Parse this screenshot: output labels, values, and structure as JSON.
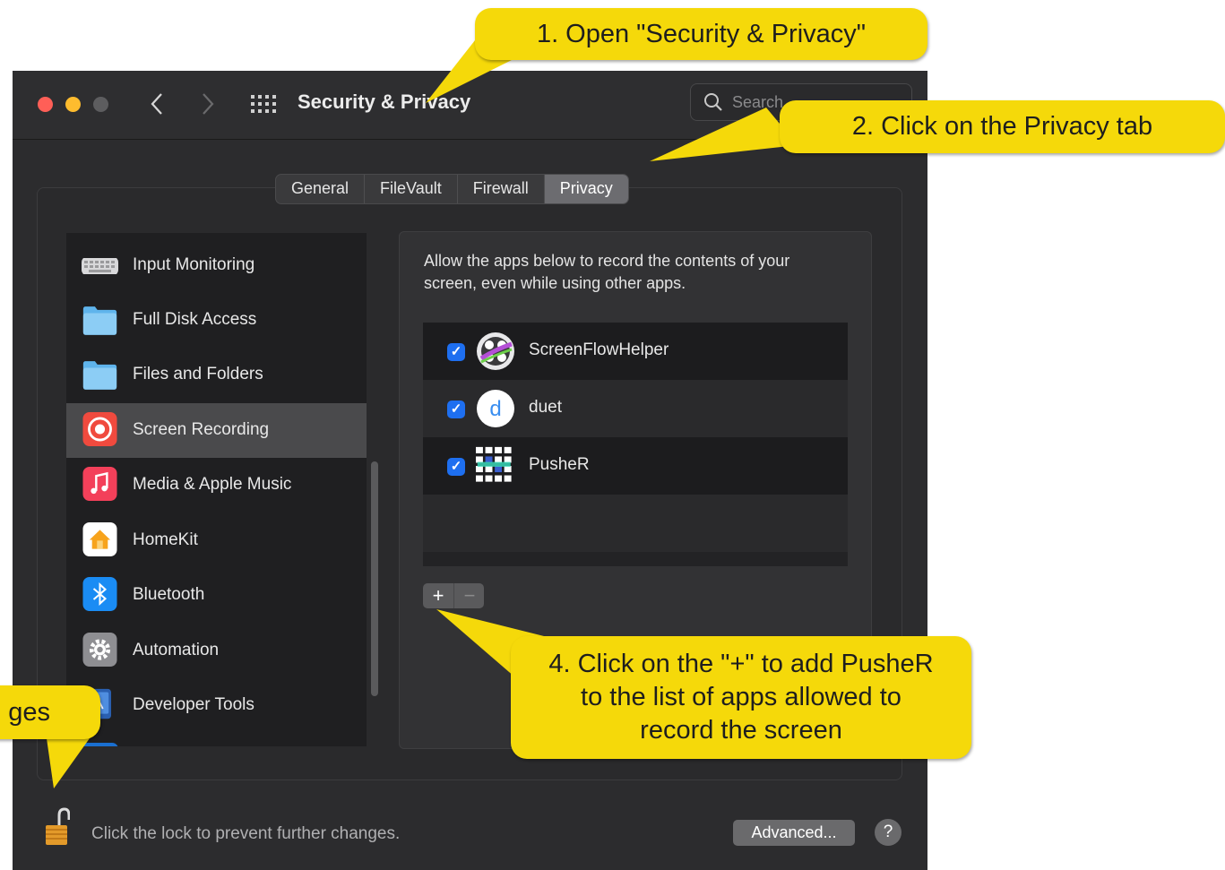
{
  "window": {
    "title": "Security & Privacy",
    "search_placeholder": "Search",
    "traffic_colors": {
      "close": "#ff5f57",
      "minimize": "#febc2e",
      "zoom": "#5d5d5f"
    }
  },
  "tabs": [
    {
      "label": "General",
      "active": false
    },
    {
      "label": "FileVault",
      "active": false
    },
    {
      "label": "Firewall",
      "active": false
    },
    {
      "label": "Privacy",
      "active": true
    }
  ],
  "sidebar": {
    "items": [
      {
        "label": "Input Monitoring",
        "icon": "keyboard-icon",
        "selected": false
      },
      {
        "label": "Full Disk Access",
        "icon": "folder-icon",
        "selected": false
      },
      {
        "label": "Files and Folders",
        "icon": "folder-icon",
        "selected": false
      },
      {
        "label": "Screen Recording",
        "icon": "screen-recording-icon",
        "selected": true
      },
      {
        "label": "Media & Apple Music",
        "icon": "music-icon",
        "selected": false
      },
      {
        "label": "HomeKit",
        "icon": "home-icon",
        "selected": false
      },
      {
        "label": "Bluetooth",
        "icon": "bluetooth-icon",
        "selected": false
      },
      {
        "label": "Automation",
        "icon": "gear-icon",
        "selected": false
      },
      {
        "label": "Developer Tools",
        "icon": "developer-tools-icon",
        "selected": false
      }
    ]
  },
  "main": {
    "description": "Allow the apps below to record the contents of your screen, even while using other apps.",
    "apps": [
      {
        "name": "ScreenFlowHelper",
        "checked": true,
        "icon": "screenflow-icon"
      },
      {
        "name": "duet",
        "checked": true,
        "icon": "duet-icon"
      },
      {
        "name": "PusheR",
        "checked": true,
        "icon": "pusher-icon"
      }
    ],
    "add_label": "+",
    "remove_label": "−"
  },
  "footer": {
    "lock_text": "Click the lock to prevent further changes.",
    "advanced_label": "Advanced...",
    "help_label": "?"
  },
  "callouts": {
    "step1": "1. Open \"Security & Privacy\"",
    "step2": "2. Click on the Privacy tab",
    "step3_fragment": "ges",
    "step4_line1": "4. Click on the \"+\" to add PusheR",
    "step4_line2": "to the list of apps allowed to",
    "step4_line3": "record the screen",
    "color": "#f5d90a"
  }
}
